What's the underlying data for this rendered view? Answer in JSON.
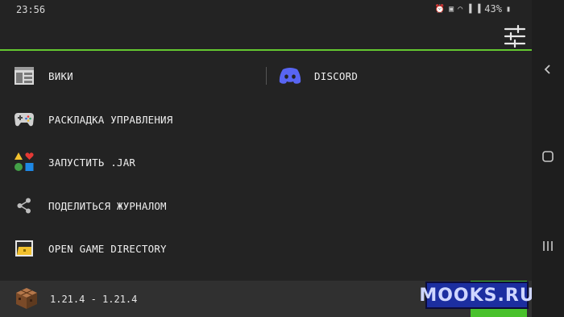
{
  "status_bar": {
    "time": "23:56",
    "battery": "43%",
    "icons": [
      "alarm-icon",
      "lock-icon",
      "wifi-icon",
      "signal-icon",
      "signal-icon",
      "battery-icon"
    ]
  },
  "menu": {
    "wiki": "ВИКИ",
    "discord": "DISCORD",
    "controls": "РАСКЛАДКА УПРАВЛЕНИЯ",
    "run_jar": "ЗАПУСТИТЬ .JAR",
    "share_log": "ПОДЕЛИТЬСЯ ЖУРНАЛОМ",
    "game_dir": "OPEN GAME DIRECTORY"
  },
  "footer": {
    "version": "1.21.4 - 1.21.4"
  },
  "watermark": {
    "text": "MOOKS.RU"
  },
  "colors": {
    "background": "#232323",
    "accent": "#64c830",
    "discord": "#5865f2",
    "play_button": "#49c12c"
  }
}
